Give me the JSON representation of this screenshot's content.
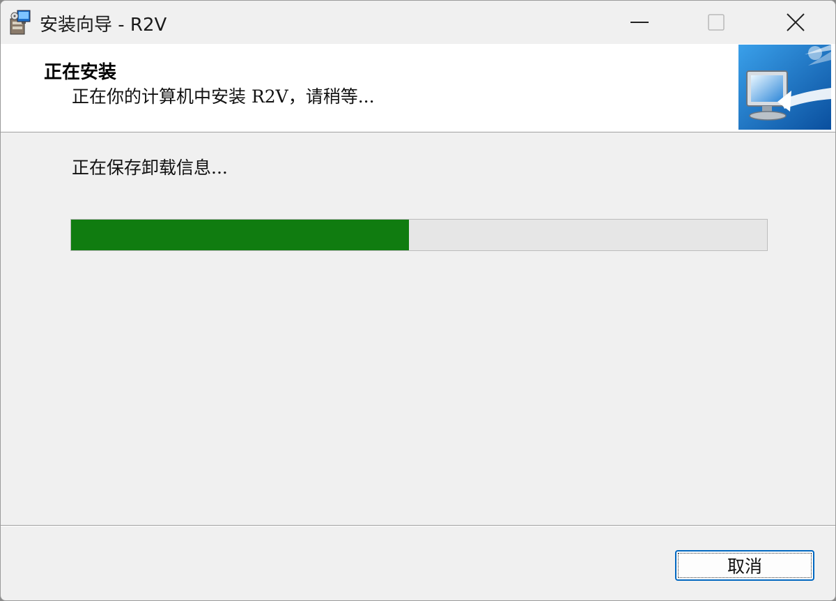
{
  "window": {
    "title": "安装向导 - R2V",
    "controls": {
      "minimize": "minimize-icon",
      "maximize": "maximize-icon",
      "close": "close-icon"
    }
  },
  "header": {
    "title": "正在安装",
    "subtitle": "正在你的计算机中安装 R2V，请稍等..."
  },
  "main": {
    "status": "正在保存卸载信息...",
    "progress_percent": 48.5
  },
  "footer": {
    "cancel_label": "取消"
  },
  "colors": {
    "progress_fill": "#107c10",
    "accent": "#0067c0"
  }
}
